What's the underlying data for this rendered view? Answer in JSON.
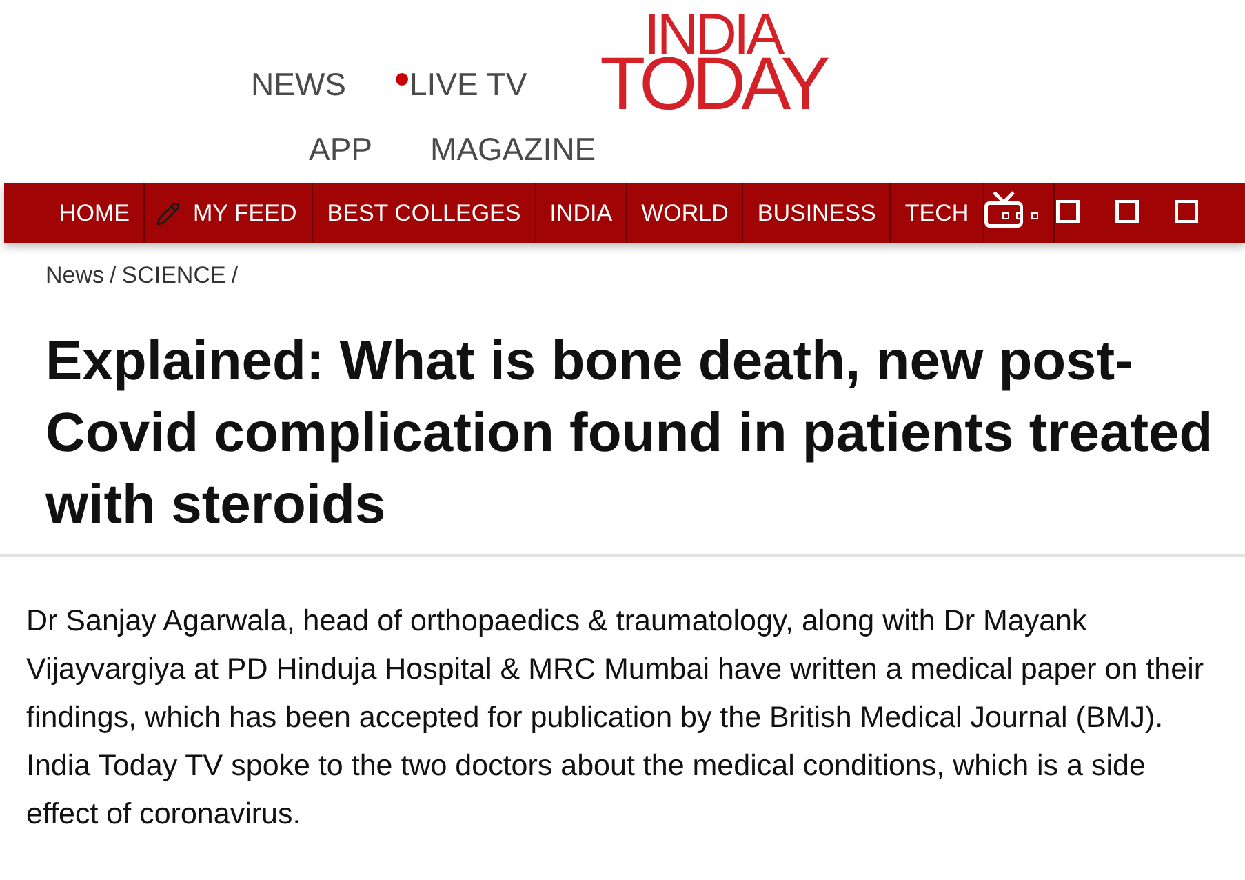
{
  "top_links": [
    [
      {
        "label": "NEWS",
        "live": false
      },
      {
        "label": "LIVE TV",
        "live": true
      }
    ],
    [
      {
        "label": "APP",
        "live": false
      },
      {
        "label": "MAGAZINE",
        "live": false
      }
    ]
  ],
  "logo": {
    "lines": [
      "INDIA",
      "TODAY"
    ]
  },
  "nav": {
    "items": [
      {
        "label": "HOME",
        "kind": "plain"
      },
      {
        "label": "MY FEED",
        "kind": "iconed"
      },
      {
        "label": "BEST COLLEGES",
        "kind": "plain"
      },
      {
        "label": "INDIA",
        "kind": "plain"
      },
      {
        "label": "WORLD",
        "kind": "plain"
      },
      {
        "label": "BUSINESS",
        "kind": "plain"
      },
      {
        "label": "TECH",
        "kind": "plain"
      }
    ]
  },
  "breadcrumb": [
    {
      "label": "News",
      "separator": "/"
    },
    {
      "label": "SCIENCE",
      "separator": "/"
    }
  ],
  "article": {
    "headline": "Explained: What is bone death, new post-Covid complication found in patients treated with steroids",
    "lead": "Dr Sanjay Agarwala, head of orthopaedics & traumatology, along with Dr Mayank Vijayvargiya at PD Hinduja Hospital & MRC Mumbai have written a medical paper on their findings, which has been accepted for publication by the British Medical Journal (BMJ). India Today TV spoke to the two doctors about the medical conditions, which is a side effect of coronavirus."
  }
}
